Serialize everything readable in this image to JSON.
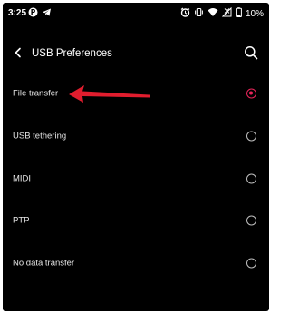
{
  "status_bar": {
    "time": "3:25",
    "battery_percent": "10%",
    "left_icons": [
      "p-app-icon",
      "telegram-icon"
    ],
    "right_icons": [
      "alarm-icon",
      "vibrate-icon",
      "wifi-icon",
      "no-signal-icon"
    ]
  },
  "header": {
    "title": "USB Preferences",
    "back_icon": "back-arrow-icon",
    "search_icon": "search-icon"
  },
  "options": [
    {
      "label": "File transfer",
      "checked": true
    },
    {
      "label": "USB tethering",
      "checked": false
    },
    {
      "label": "MIDI",
      "checked": false
    },
    {
      "label": "PTP",
      "checked": false
    },
    {
      "label": "No data transfer",
      "checked": false
    }
  ],
  "colors": {
    "background": "#000000",
    "accent": "#e8255a",
    "annotation_arrow": "#e11d2e",
    "text": "#e6e6e6"
  }
}
